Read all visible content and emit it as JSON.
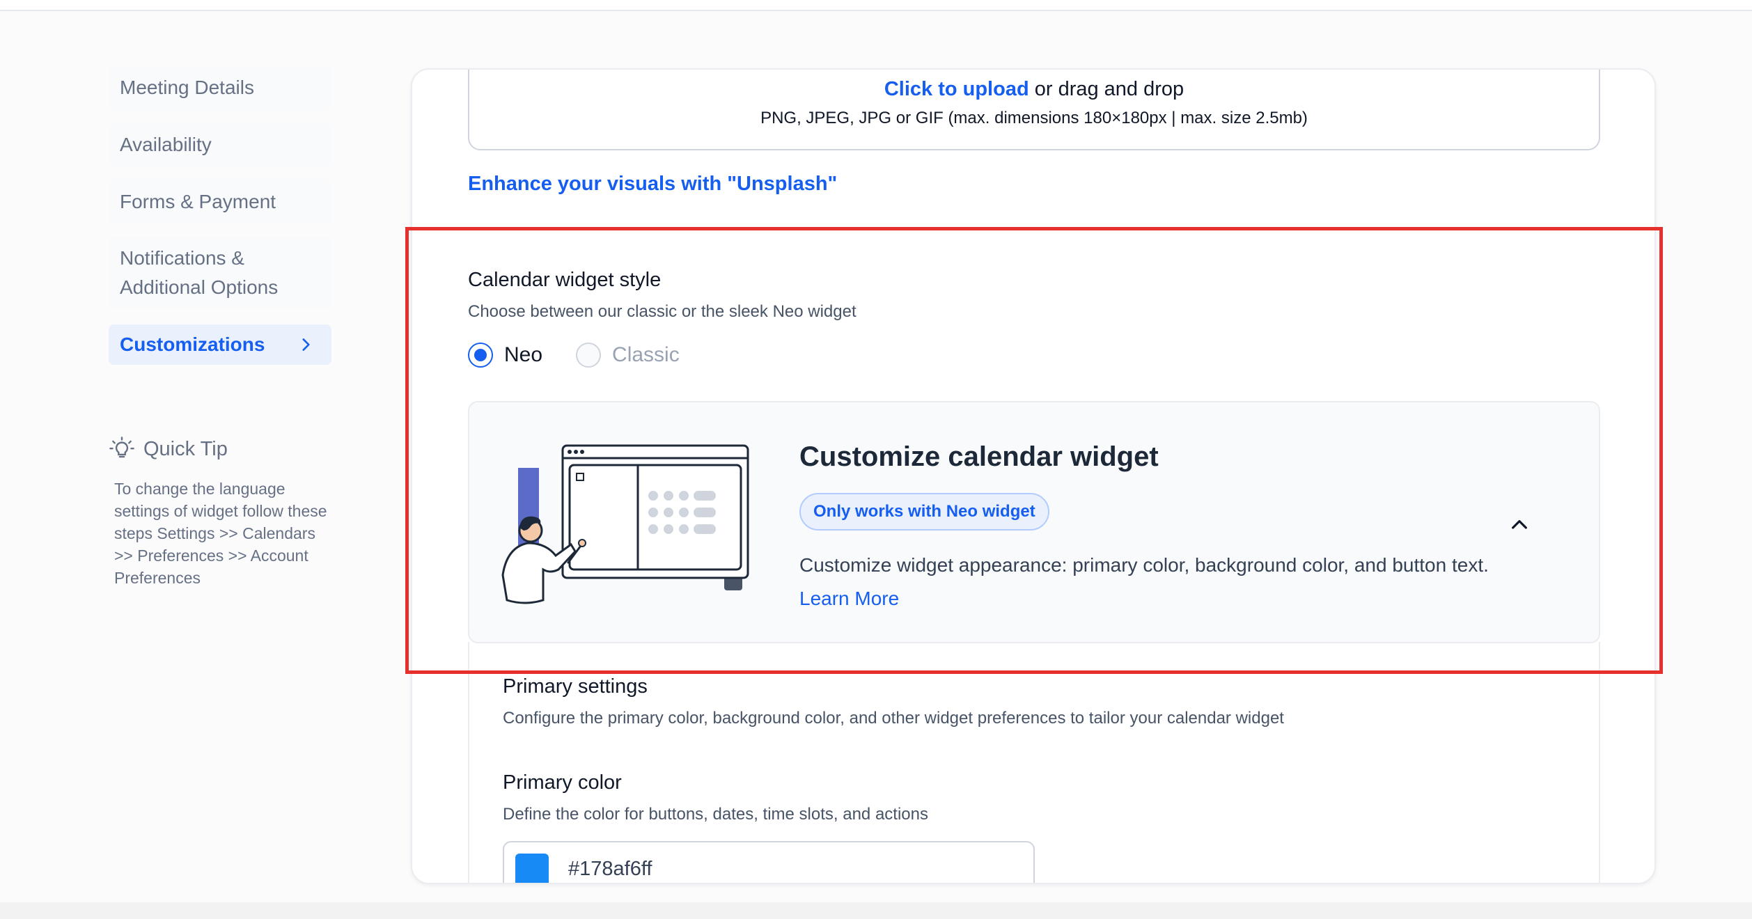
{
  "sidebar": {
    "items": [
      {
        "label": "Meeting Details"
      },
      {
        "label": "Availability"
      },
      {
        "label": "Forms & Payment"
      },
      {
        "label_line1": "Notifications &",
        "label_line2": "Additional Options"
      },
      {
        "label": "Customizations",
        "active": true
      }
    ],
    "quick_tip": {
      "title": "Quick Tip",
      "text": "To change the language settings of widget follow these steps Settings >> Calendars >> Preferences >> Account Preferences"
    }
  },
  "upload": {
    "link_text": "Click to upload",
    "rest_text": " or drag and drop",
    "hint": "PNG, JPEG, JPG or GIF (max. dimensions 180×180px | max. size 2.5mb)"
  },
  "unsplash_link": "Enhance your visuals with \"Unsplash\"",
  "calendar_widget": {
    "title": "Calendar widget style",
    "subtitle": "Choose between our classic or the sleek Neo widget",
    "options": [
      {
        "label": "Neo",
        "selected": true
      },
      {
        "label": "Classic",
        "selected": false
      }
    ]
  },
  "promo": {
    "title": "Customize calendar widget",
    "badge": "Only works with Neo widget",
    "description": "Customize widget appearance: primary color, background color, and button text.",
    "learn_more": "Learn More"
  },
  "primary_settings": {
    "title": "Primary settings",
    "subtitle": "Configure the primary color, background color, and other widget preferences to tailor your calendar widget"
  },
  "primary_color": {
    "title": "Primary color",
    "subtitle": "Define the color for buttons, dates, time slots, and actions",
    "value": "#178af6ff",
    "swatch": "#178af6"
  },
  "colors": {
    "accent": "#155eef",
    "highlight": "#e5302b"
  }
}
